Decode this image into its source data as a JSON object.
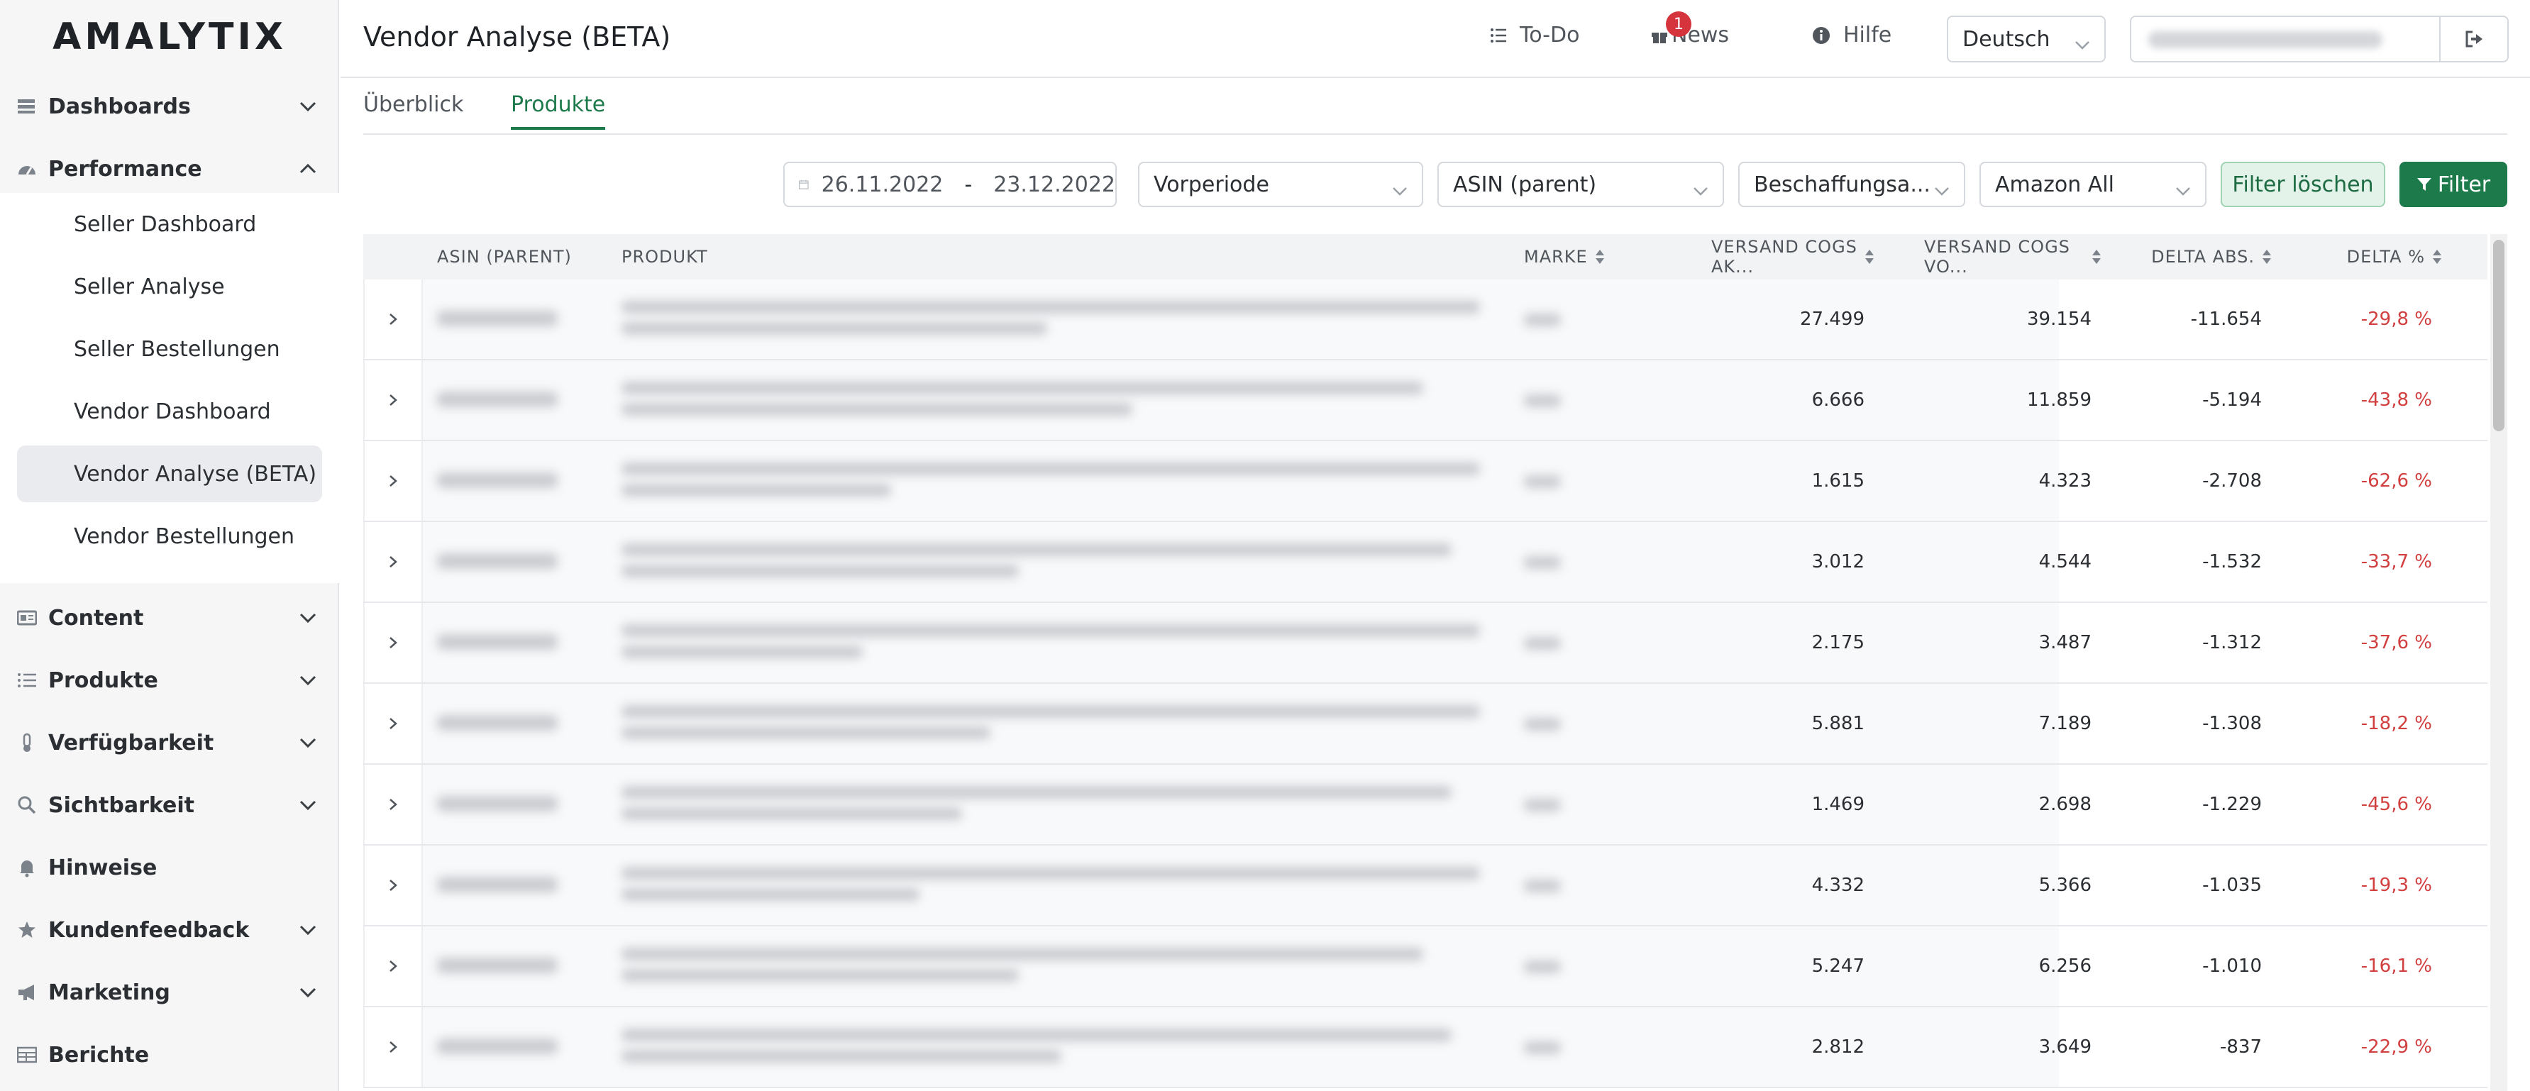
{
  "app": {
    "logo": "AMALYTIX"
  },
  "sidebar": {
    "groups": [
      {
        "label": "Dashboards",
        "icon": "dashboard-icon",
        "expanded": false
      },
      {
        "label": "Performance",
        "icon": "gauge-icon",
        "expanded": true
      },
      {
        "label": "Content",
        "icon": "content-icon",
        "expanded": false
      },
      {
        "label": "Produkte",
        "icon": "list-icon",
        "expanded": false
      },
      {
        "label": "Verfügbarkeit",
        "icon": "thermometer-icon",
        "expanded": false
      },
      {
        "label": "Sichtbarkeit",
        "icon": "search-icon",
        "expanded": false
      },
      {
        "label": "Hinweise",
        "icon": "bell-icon",
        "expanded": false
      },
      {
        "label": "Kundenfeedback",
        "icon": "star-icon",
        "expanded": false
      },
      {
        "label": "Marketing",
        "icon": "megaphone-icon",
        "expanded": false
      },
      {
        "label": "Berichte",
        "icon": "table-icon",
        "expanded": false
      }
    ],
    "performance_items": [
      "Seller Dashboard",
      "Seller Analyse",
      "Seller Bestellungen",
      "Vendor Dashboard",
      "Vendor Analyse (BETA)",
      "Vendor Bestellungen"
    ],
    "active_item": "Vendor Analyse (BETA)"
  },
  "header": {
    "title": "Vendor Analyse (BETA)",
    "todo_label": "To-Do",
    "news_label": "News",
    "news_badge": "1",
    "help_label": "Hilfe",
    "language": "Deutsch"
  },
  "tabs": [
    {
      "label": "Überblick",
      "active": false
    },
    {
      "label": "Produkte",
      "active": true
    }
  ],
  "filters": {
    "date_from": "26.11.2022",
    "date_separator": "-",
    "date_to": "23.12.2022",
    "comparison": "Vorperiode",
    "grouping": "ASIN (parent)",
    "source": "Beschaffungsa...",
    "marketplace": "Amazon All",
    "clear_label": "Filter löschen",
    "filter_label": "Filter"
  },
  "table": {
    "columns": [
      "ASIN (PARENT)",
      "PRODUKT",
      "MARKE",
      "VERSAND COGS AK...",
      "VERSAND COGS VO...",
      "DELTA ABS.",
      "DELTA %"
    ],
    "rows": [
      {
        "cogs_current": "27.499",
        "cogs_previous": "39.154",
        "delta_abs": "-11.654",
        "delta_pct": "-29,8 %"
      },
      {
        "cogs_current": "6.666",
        "cogs_previous": "11.859",
        "delta_abs": "-5.194",
        "delta_pct": "-43,8 %"
      },
      {
        "cogs_current": "1.615",
        "cogs_previous": "4.323",
        "delta_abs": "-2.708",
        "delta_pct": "-62,6 %"
      },
      {
        "cogs_current": "3.012",
        "cogs_previous": "4.544",
        "delta_abs": "-1.532",
        "delta_pct": "-33,7 %"
      },
      {
        "cogs_current": "2.175",
        "cogs_previous": "3.487",
        "delta_abs": "-1.312",
        "delta_pct": "-37,6 %"
      },
      {
        "cogs_current": "5.881",
        "cogs_previous": "7.189",
        "delta_abs": "-1.308",
        "delta_pct": "-18,2 %"
      },
      {
        "cogs_current": "1.469",
        "cogs_previous": "2.698",
        "delta_abs": "-1.229",
        "delta_pct": "-45,6 %"
      },
      {
        "cogs_current": "4.332",
        "cogs_previous": "5.366",
        "delta_abs": "-1.035",
        "delta_pct": "-19,3 %"
      },
      {
        "cogs_current": "5.247",
        "cogs_previous": "6.256",
        "delta_abs": "-1.010",
        "delta_pct": "-16,1 %"
      },
      {
        "cogs_current": "2.812",
        "cogs_previous": "3.649",
        "delta_abs": "-837",
        "delta_pct": "-22,9 %"
      }
    ]
  },
  "colors": {
    "accent": "#1d7a4b",
    "negative": "#d23f3f",
    "badge": "#d6343d"
  }
}
